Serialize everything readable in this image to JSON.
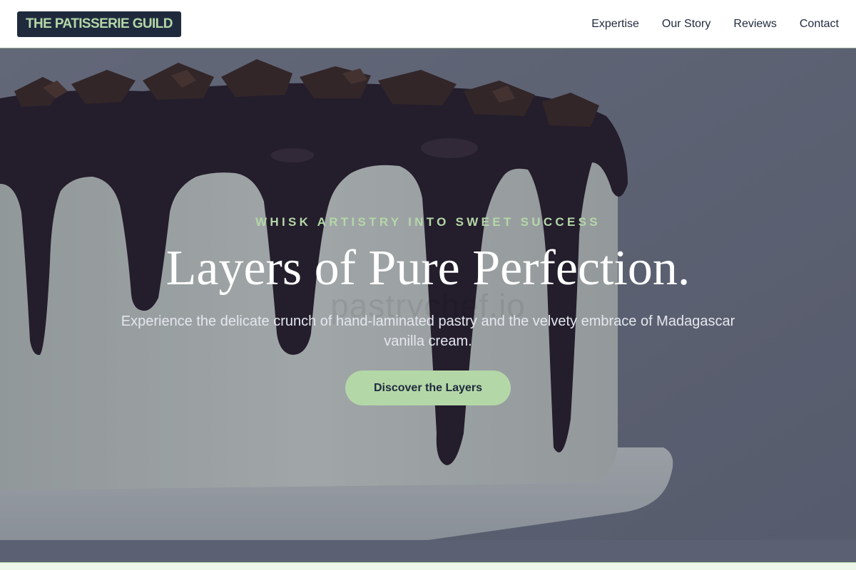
{
  "header": {
    "logo": "THE PATISSERIE GUILD",
    "nav": [
      "Expertise",
      "Our Story",
      "Reviews",
      "Contact"
    ]
  },
  "hero": {
    "eyebrow": "WHISK ARTISTRY INTO SWEET SUCCESS",
    "headline": "Layers of Pure Perfection.",
    "subtext": "Experience the delicate crunch of hand-laminated pastry and the velvety embrace of Madagascar vanilla cream.",
    "cta_label": "Discover the Layers",
    "background_image": "chocolate-drip-cake-photo"
  },
  "colors": {
    "brand_dark": "#1f2a3d",
    "accent_green": "#b4d7a8",
    "header_bg": "#ffffff"
  }
}
